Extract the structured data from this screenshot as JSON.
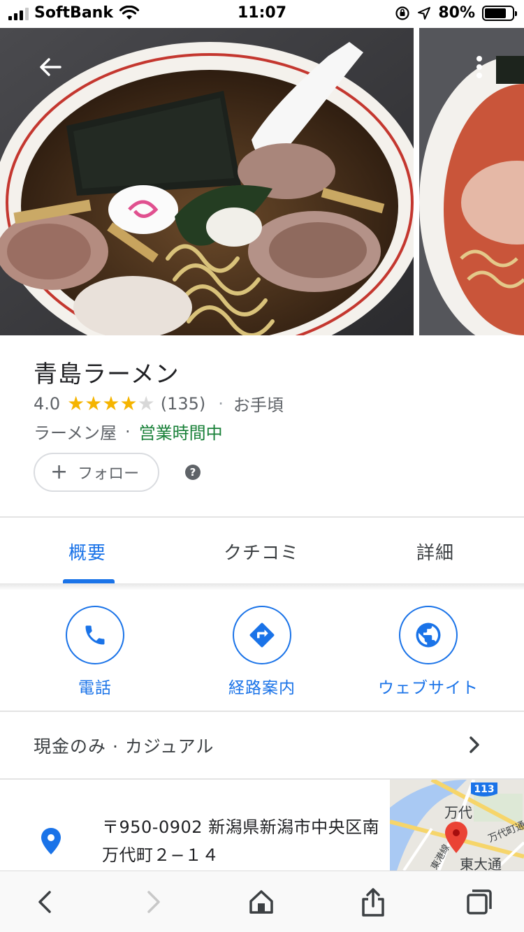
{
  "status_bar": {
    "carrier": "SoftBank",
    "time": "11:07",
    "battery": "80%",
    "battery_level": 0.8
  },
  "photos": {
    "back_icon": "arrow-left-icon",
    "more_icon": "more-vertical-icon"
  },
  "place": {
    "name": "青島ラーメン",
    "rating": "4.0",
    "stars_filled": 4,
    "stars_total": 5,
    "review_count": "(135)",
    "price_sep": "·",
    "price": "お手頃",
    "category": "ラーメン屋",
    "category_sep": "·",
    "open_status": "営業時間中",
    "follow_label": "フォロー",
    "help_icon": "?"
  },
  "tabs": [
    {
      "label": "概要",
      "active": true
    },
    {
      "label": "クチコミ",
      "active": false
    },
    {
      "label": "詳細",
      "active": false
    }
  ],
  "actions": [
    {
      "label": "電話",
      "icon": "phone-icon"
    },
    {
      "label": "経路案内",
      "icon": "directions-icon"
    },
    {
      "label": "ウェブサイト",
      "icon": "globe-icon"
    }
  ],
  "attributes": {
    "text": "現金のみ · カジュアル"
  },
  "address": {
    "text": "〒950-0902 新潟県新潟市中央区南万代町２−１４",
    "map": {
      "route_number": "113",
      "labels": [
        "万代",
        "万代町通",
        "東港線",
        "東大通"
      ]
    }
  },
  "colors": {
    "accent": "#1a73e8",
    "open": "#188038",
    "star": "#f5b400",
    "pin": "#ea4335"
  }
}
